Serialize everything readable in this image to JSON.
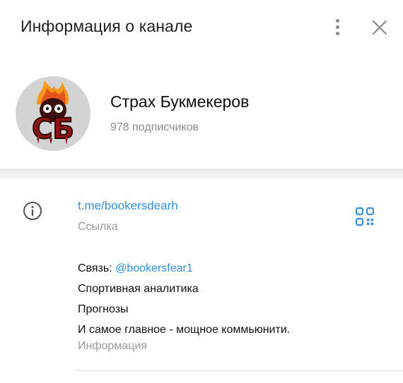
{
  "header": {
    "title": "Информация о канале",
    "menu_icon": "kebab-menu-icon",
    "close_icon": "close-icon"
  },
  "channel": {
    "name": "Страх Букмекеров",
    "subscribers": "978 подписчиков",
    "avatar_text": "CБ"
  },
  "link_section": {
    "link": "t.me/bookersdearh",
    "caption": "Ссылка",
    "icon": "info-icon",
    "qr_icon": "qr-code-icon"
  },
  "description": {
    "contact_prefix": "Связь: ",
    "contact_handle": "@bookersfear1",
    "line2": "Спортивная аналитика",
    "line3": "Прогнозы",
    "line4": "И самое главное - мощное коммьюнити.",
    "caption": "Информация"
  },
  "colors": {
    "accent": "#3a8fd6",
    "muted": "#9a9a9a",
    "avatar_bg": "#d3d3d3",
    "logo_red": "#8e1414"
  }
}
